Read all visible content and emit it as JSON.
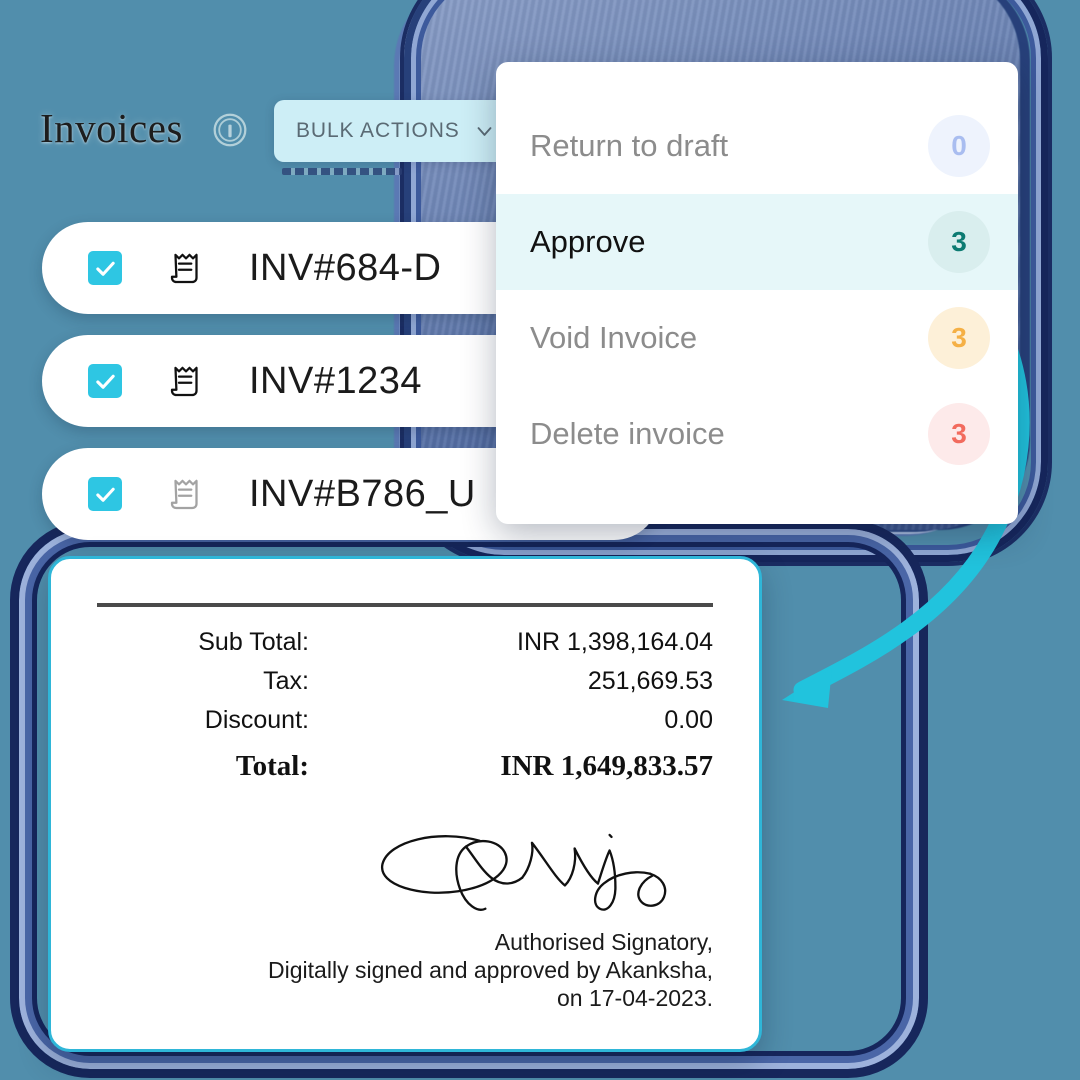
{
  "theme": {
    "background": "#518eac",
    "accent_cyan": "#2ec6e3",
    "card_border": "#2fb6d8",
    "bulk_button_bg": "#cdeef6",
    "menu_active_bg": "#e6f7f9"
  },
  "header": {
    "title": "Invoices",
    "info_icon": "info-circle-icon",
    "bulk_actions": {
      "label": "BULK ACTIONS",
      "chevron_icon": "chevron-down-icon"
    }
  },
  "invoice_list": {
    "rows": [
      {
        "id": "INV#684-D",
        "checked": true,
        "icon": "receipt-icon",
        "icon_state": "active"
      },
      {
        "id": "INV#1234",
        "checked": true,
        "icon": "receipt-icon",
        "icon_state": "active"
      },
      {
        "id": "INV#B786_U",
        "checked": true,
        "icon": "receipt-icon",
        "icon_state": "muted"
      }
    ],
    "checkbox_icon": "checkmark-icon"
  },
  "bulk_menu": {
    "items": [
      {
        "label": "Return to draft",
        "count": "0",
        "state": "default"
      },
      {
        "label": "Approve",
        "count": "3",
        "state": "active"
      },
      {
        "label": "Void Invoice",
        "count": "3",
        "state": "default"
      },
      {
        "label": "Delete invoice",
        "count": "3",
        "state": "default"
      }
    ]
  },
  "invoice_card": {
    "totals": [
      {
        "label": "Sub Total:",
        "value": "INR  1,398,164.04"
      },
      {
        "label": "Tax:",
        "value": "251,669.53"
      },
      {
        "label": "Discount:",
        "value": "0.00"
      }
    ],
    "grand_total": {
      "label": "Total:",
      "value": "INR  1,649,833.57"
    },
    "signature_icon": "handwritten-signature-icon",
    "signature_lines": [
      "Authorised Signatory,",
      "Digitally signed and approved by Akanksha,",
      "on 17-04-2023."
    ]
  },
  "decoration": {
    "arrow_icon": "curved-arrow-icon"
  }
}
